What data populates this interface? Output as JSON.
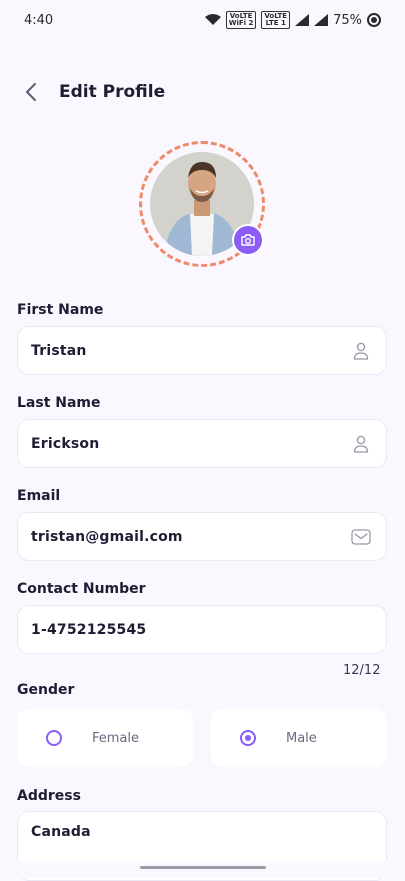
{
  "status_bar": {
    "time": "4:40",
    "badge1_top": "VoLTE",
    "badge1_bottom": "WiFi 2",
    "badge2_top": "VoLTE",
    "badge2_bottom": "LTE 1",
    "battery": "75%"
  },
  "appbar": {
    "title": "Edit Profile"
  },
  "form": {
    "first_name": {
      "label": "First Name",
      "value": "Tristan"
    },
    "last_name": {
      "label": "Last Name",
      "value": "Erickson"
    },
    "email": {
      "label": "Email",
      "value": "tristan@gmail.com"
    },
    "contact": {
      "label": "Contact Number",
      "value": "1-4752125545",
      "counter": "12/12"
    },
    "gender": {
      "label": "Gender",
      "options": [
        "Female",
        "Male"
      ],
      "selected": "Male"
    },
    "address": {
      "label": "Address",
      "value": "Canada"
    }
  },
  "colors": {
    "accent": "#8b5cf6",
    "ring": "#ef8a6b",
    "background": "#faf7ff"
  }
}
